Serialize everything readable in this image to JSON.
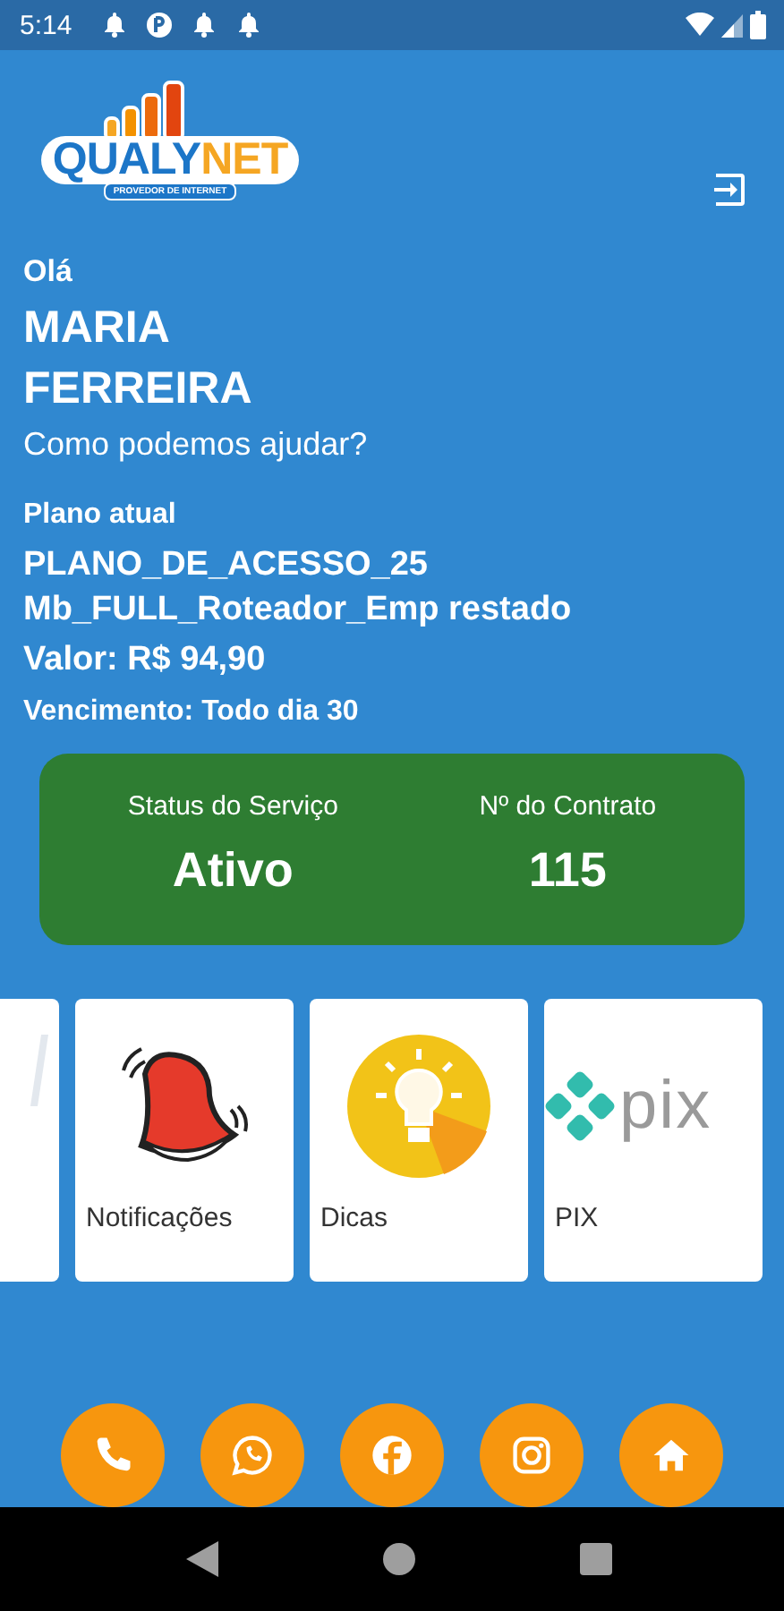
{
  "status_bar": {
    "time": "5:14",
    "notifications": [
      {
        "kind": "bell"
      },
      {
        "kind": "data"
      },
      {
        "kind": "bell"
      },
      {
        "kind": "bell"
      }
    ]
  },
  "header": {
    "logo": {
      "name": "QUALY",
      "name_accent": "NET",
      "tagline": "PROVEDOR DE INTERNET"
    }
  },
  "greeting": {
    "hello": "Olá",
    "name": "MARIA FERREIRA",
    "prompt": "Como podemos ajudar?"
  },
  "plan": {
    "label": "Plano atual",
    "name": "PLANO_DE_ACESSO_25 Mb_FULL_Roteador_Emp restado",
    "price": "Valor: R$ 94,90",
    "due": "Vencimento: Todo dia 30"
  },
  "service_card": {
    "items": [
      {
        "label": "Status do Serviço",
        "value": "Ativo"
      },
      {
        "label": "Nº do Contrato",
        "value": "115"
      }
    ]
  },
  "shortcuts": [
    {
      "kind": "partial"
    },
    {
      "kind": "bell",
      "label": "Notificações"
    },
    {
      "kind": "bulb",
      "label": "Dicas"
    },
    {
      "kind": "pix",
      "label": "PIX",
      "logo_text": "pix"
    }
  ],
  "contact_buttons": [
    {
      "kind": "phone"
    },
    {
      "kind": "whatsapp"
    },
    {
      "kind": "facebook"
    },
    {
      "kind": "instagram"
    },
    {
      "kind": "home"
    }
  ]
}
